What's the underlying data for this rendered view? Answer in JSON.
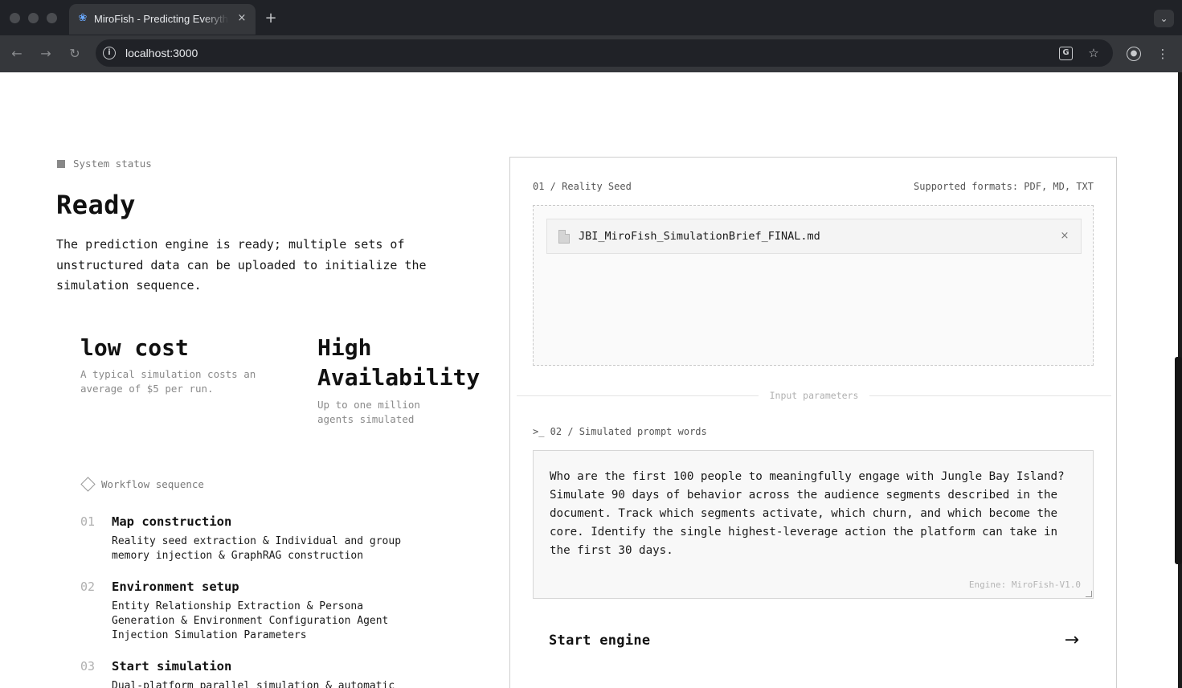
{
  "browser": {
    "tab_title": "MiroFish - Predicting Everything",
    "tab_close": "×",
    "new_tab": "+",
    "tab_menu": "⌄",
    "url": "localhost:3000",
    "nav": {
      "back": "←",
      "forward": "→",
      "reload": "↻"
    },
    "icons": [
      "translate-icon",
      "bookmark-star-icon",
      "profile-icon",
      "more-menu-icon"
    ]
  },
  "left": {
    "status_label": "System status",
    "status_title": "Ready",
    "status_description": "The prediction engine is ready; multiple sets of unstructured data can be uploaded to initialize the simulation sequence.",
    "metrics": [
      {
        "title": "low cost",
        "description": "A typical simulation costs an average of $5 per run."
      },
      {
        "title": "High Availability",
        "description": "Up to one million agents simulated"
      }
    ],
    "workflow_label": "Workflow sequence",
    "steps": [
      {
        "num": "01",
        "title": "Map construction",
        "description": "Reality seed extraction & Individual and group memory injection & GraphRAG construction"
      },
      {
        "num": "02",
        "title": "Environment setup",
        "description": "Entity Relationship Extraction & Persona Generation & Environment Configuration Agent Injection Simulation Parameters"
      },
      {
        "num": "03",
        "title": "Start simulation",
        "description": "Dual-platform parallel simulation & automatic"
      }
    ]
  },
  "card": {
    "seed_label": "01 / Reality Seed",
    "formats_label": "Supported formats: PDF, MD, TXT",
    "file": {
      "name": "JBI_MiroFish_SimulationBrief_FINAL.md",
      "remove": "×"
    },
    "divider_label": "Input parameters",
    "prompt_label": ">_ 02 / Simulated prompt words",
    "prompt_text": "Who are the first 100 people to meaningfully engage with Jungle Bay Island? Simulate 90 days of behavior across the audience segments described in the document. Track which segments activate, which churn, and which become the core. Identify the single highest-leverage action the platform can take in the first 30 days.",
    "engine_label": "Engine: MiroFish-V1.0",
    "start_label": "Start engine",
    "start_arrow": "→"
  }
}
